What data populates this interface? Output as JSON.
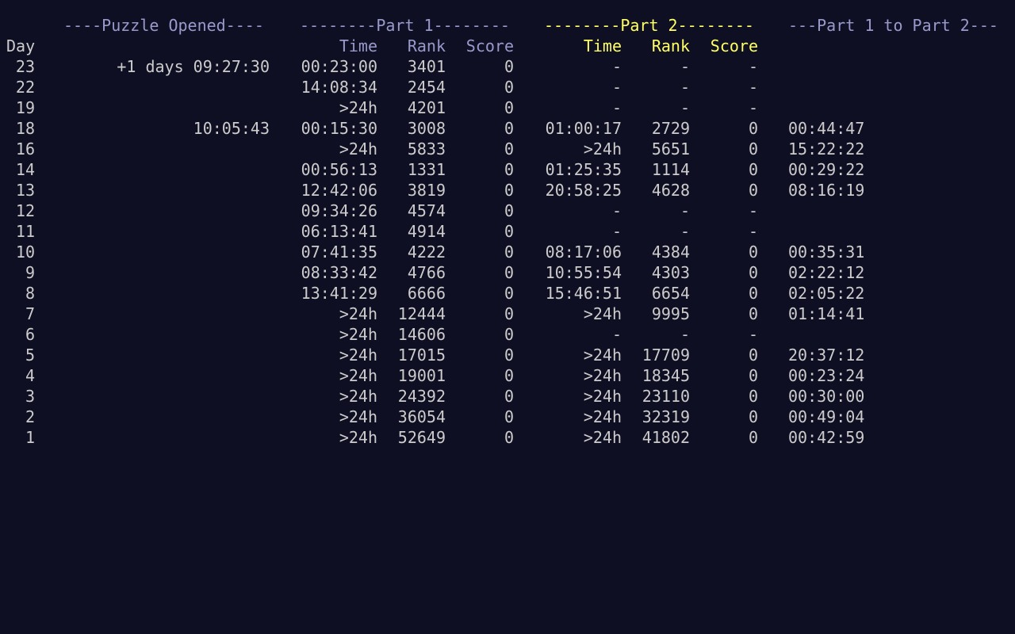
{
  "groups": {
    "opened": "----Puzzle Opened----",
    "part1": "--------Part 1--------",
    "part2": "--------Part 2--------",
    "delta": "---Part 1 to Part 2---"
  },
  "columns": {
    "day": "Day",
    "time1": "Time",
    "rank1": "Rank",
    "score1": "Score",
    "time2": "Time",
    "rank2": "Rank",
    "score2": "Score"
  },
  "rows": [
    {
      "day": "23",
      "opened": "+1 days 09:27:30",
      "p1_time": "00:23:00",
      "p1_rank": "3401",
      "p1_score": "0",
      "p2_time": "-",
      "p2_rank": "-",
      "p2_score": "-",
      "delta": ""
    },
    {
      "day": "22",
      "opened": "",
      "p1_time": "14:08:34",
      "p1_rank": "2454",
      "p1_score": "0",
      "p2_time": "-",
      "p2_rank": "-",
      "p2_score": "-",
      "delta": ""
    },
    {
      "day": "19",
      "opened": "",
      "p1_time": ">24h",
      "p1_rank": "4201",
      "p1_score": "0",
      "p2_time": "-",
      "p2_rank": "-",
      "p2_score": "-",
      "delta": ""
    },
    {
      "day": "18",
      "opened": "10:05:43",
      "p1_time": "00:15:30",
      "p1_rank": "3008",
      "p1_score": "0",
      "p2_time": "01:00:17",
      "p2_rank": "2729",
      "p2_score": "0",
      "delta": "00:44:47"
    },
    {
      "day": "16",
      "opened": "",
      "p1_time": ">24h",
      "p1_rank": "5833",
      "p1_score": "0",
      "p2_time": ">24h",
      "p2_rank": "5651",
      "p2_score": "0",
      "delta": "15:22:22"
    },
    {
      "day": "14",
      "opened": "",
      "p1_time": "00:56:13",
      "p1_rank": "1331",
      "p1_score": "0",
      "p2_time": "01:25:35",
      "p2_rank": "1114",
      "p2_score": "0",
      "delta": "00:29:22"
    },
    {
      "day": "13",
      "opened": "",
      "p1_time": "12:42:06",
      "p1_rank": "3819",
      "p1_score": "0",
      "p2_time": "20:58:25",
      "p2_rank": "4628",
      "p2_score": "0",
      "delta": "08:16:19"
    },
    {
      "day": "12",
      "opened": "",
      "p1_time": "09:34:26",
      "p1_rank": "4574",
      "p1_score": "0",
      "p2_time": "-",
      "p2_rank": "-",
      "p2_score": "-",
      "delta": ""
    },
    {
      "day": "11",
      "opened": "",
      "p1_time": "06:13:41",
      "p1_rank": "4914",
      "p1_score": "0",
      "p2_time": "-",
      "p2_rank": "-",
      "p2_score": "-",
      "delta": ""
    },
    {
      "day": "10",
      "opened": "",
      "p1_time": "07:41:35",
      "p1_rank": "4222",
      "p1_score": "0",
      "p2_time": "08:17:06",
      "p2_rank": "4384",
      "p2_score": "0",
      "delta": "00:35:31"
    },
    {
      "day": "9",
      "opened": "",
      "p1_time": "08:33:42",
      "p1_rank": "4766",
      "p1_score": "0",
      "p2_time": "10:55:54",
      "p2_rank": "4303",
      "p2_score": "0",
      "delta": "02:22:12"
    },
    {
      "day": "8",
      "opened": "",
      "p1_time": "13:41:29",
      "p1_rank": "6666",
      "p1_score": "0",
      "p2_time": "15:46:51",
      "p2_rank": "6654",
      "p2_score": "0",
      "delta": "02:05:22"
    },
    {
      "day": "7",
      "opened": "",
      "p1_time": ">24h",
      "p1_rank": "12444",
      "p1_score": "0",
      "p2_time": ">24h",
      "p2_rank": "9995",
      "p2_score": "0",
      "delta": "01:14:41"
    },
    {
      "day": "6",
      "opened": "",
      "p1_time": ">24h",
      "p1_rank": "14606",
      "p1_score": "0",
      "p2_time": "-",
      "p2_rank": "-",
      "p2_score": "-",
      "delta": ""
    },
    {
      "day": "5",
      "opened": "",
      "p1_time": ">24h",
      "p1_rank": "17015",
      "p1_score": "0",
      "p2_time": ">24h",
      "p2_rank": "17709",
      "p2_score": "0",
      "delta": "20:37:12"
    },
    {
      "day": "4",
      "opened": "",
      "p1_time": ">24h",
      "p1_rank": "19001",
      "p1_score": "0",
      "p2_time": ">24h",
      "p2_rank": "18345",
      "p2_score": "0",
      "delta": "00:23:24"
    },
    {
      "day": "3",
      "opened": "",
      "p1_time": ">24h",
      "p1_rank": "24392",
      "p1_score": "0",
      "p2_time": ">24h",
      "p2_rank": "23110",
      "p2_score": "0",
      "delta": "00:30:00"
    },
    {
      "day": "2",
      "opened": "",
      "p1_time": ">24h",
      "p1_rank": "36054",
      "p1_score": "0",
      "p2_time": ">24h",
      "p2_rank": "32319",
      "p2_score": "0",
      "delta": "00:49:04"
    },
    {
      "day": "1",
      "opened": "",
      "p1_time": ">24h",
      "p1_rank": "52649",
      "p1_score": "0",
      "p2_time": ">24h",
      "p2_rank": "41802",
      "p2_score": "0",
      "delta": "00:42:59"
    }
  ],
  "colors": {
    "background": "#0f0f23",
    "text": "#cccccc",
    "muted_header": "#9999cc",
    "part2_header": "#ffff66"
  }
}
